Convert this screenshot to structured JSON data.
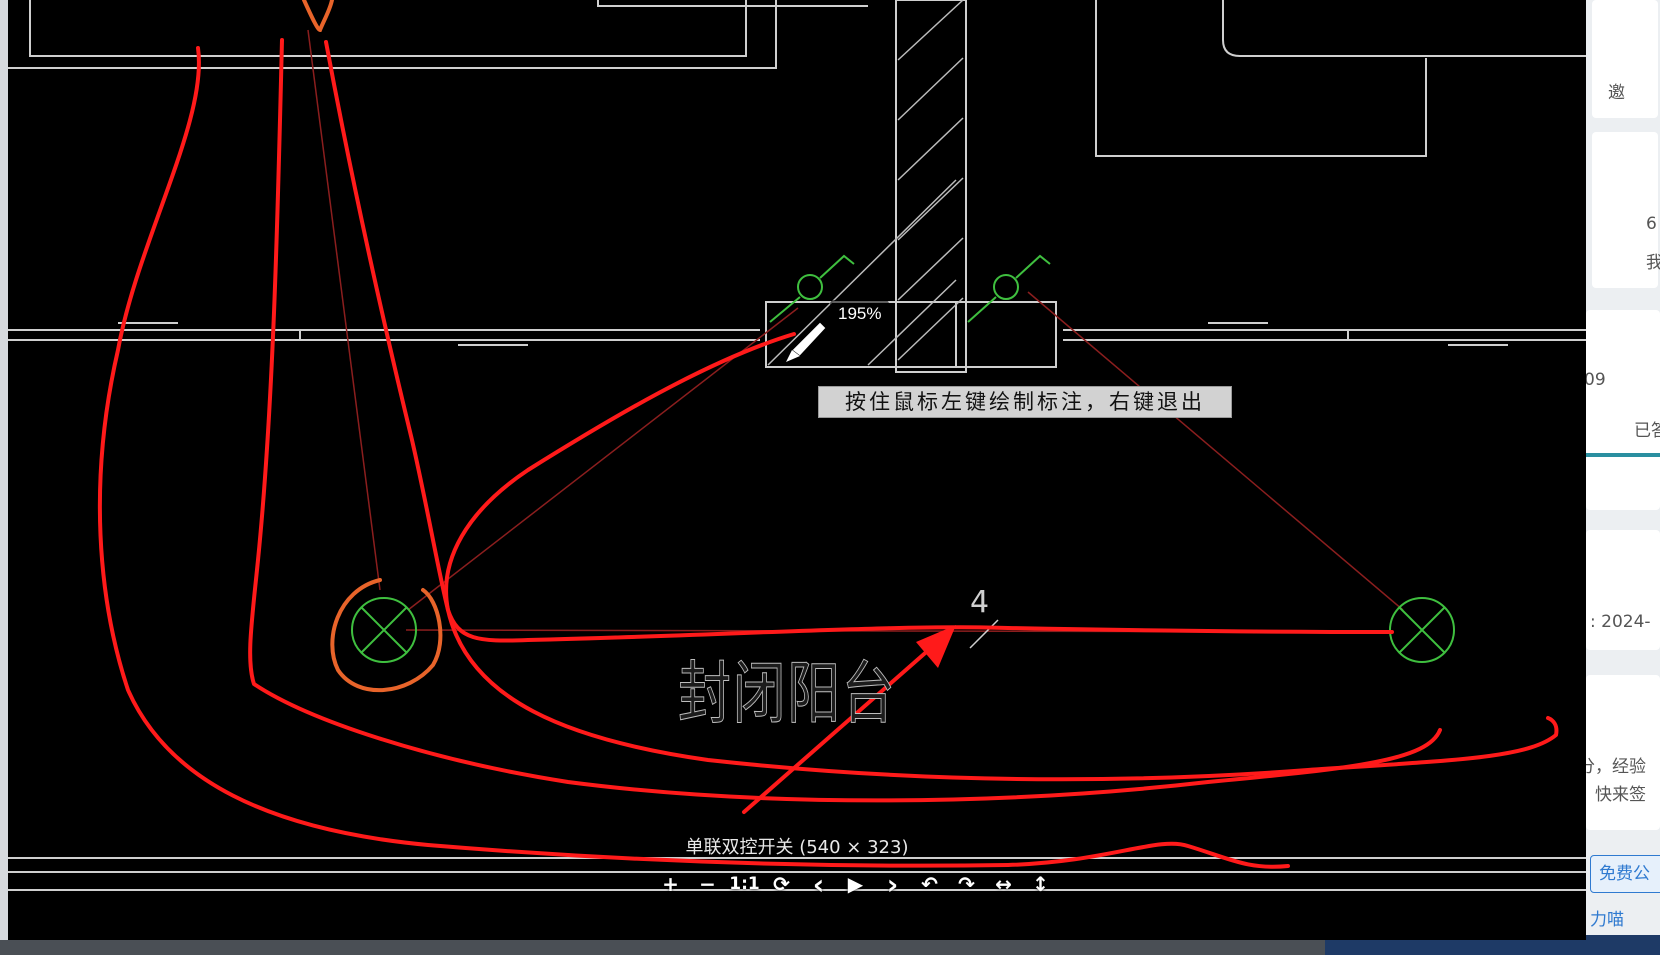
{
  "viewer": {
    "zoom": "195%",
    "tooltip": "按住鼠标左键绘制标注，右键退出",
    "room_label": "封闭阳台",
    "wire_count_mark": "4",
    "caption": "单联双控开关 (540 × 323)"
  },
  "toolbar": {
    "zoom_in": "+",
    "zoom_out": "−",
    "actual_size": "1:1",
    "rotate": "⟳",
    "prev": "‹",
    "play": "▶",
    "next": "›",
    "rotate_left": "↶",
    "rotate_right": "↷",
    "flip_h": "↔",
    "flip_v": "↕"
  },
  "background_page": {
    "text_1": "邀",
    "text_2": "6",
    "text_3": "我",
    "text_4": "09",
    "text_5": "已答",
    "text_6": "] : 2024-",
    "text_7": "分，经验",
    "text_8": "，快来签",
    "float_button": "免费公",
    "float_sub": "力喵"
  },
  "colors": {
    "annotation": "#ff1a1a",
    "highlight": "#e8642a",
    "cad_lines": "#cfcfcf",
    "cad_fixture": "#3fbf3f",
    "wire": "#8b1e1e"
  }
}
